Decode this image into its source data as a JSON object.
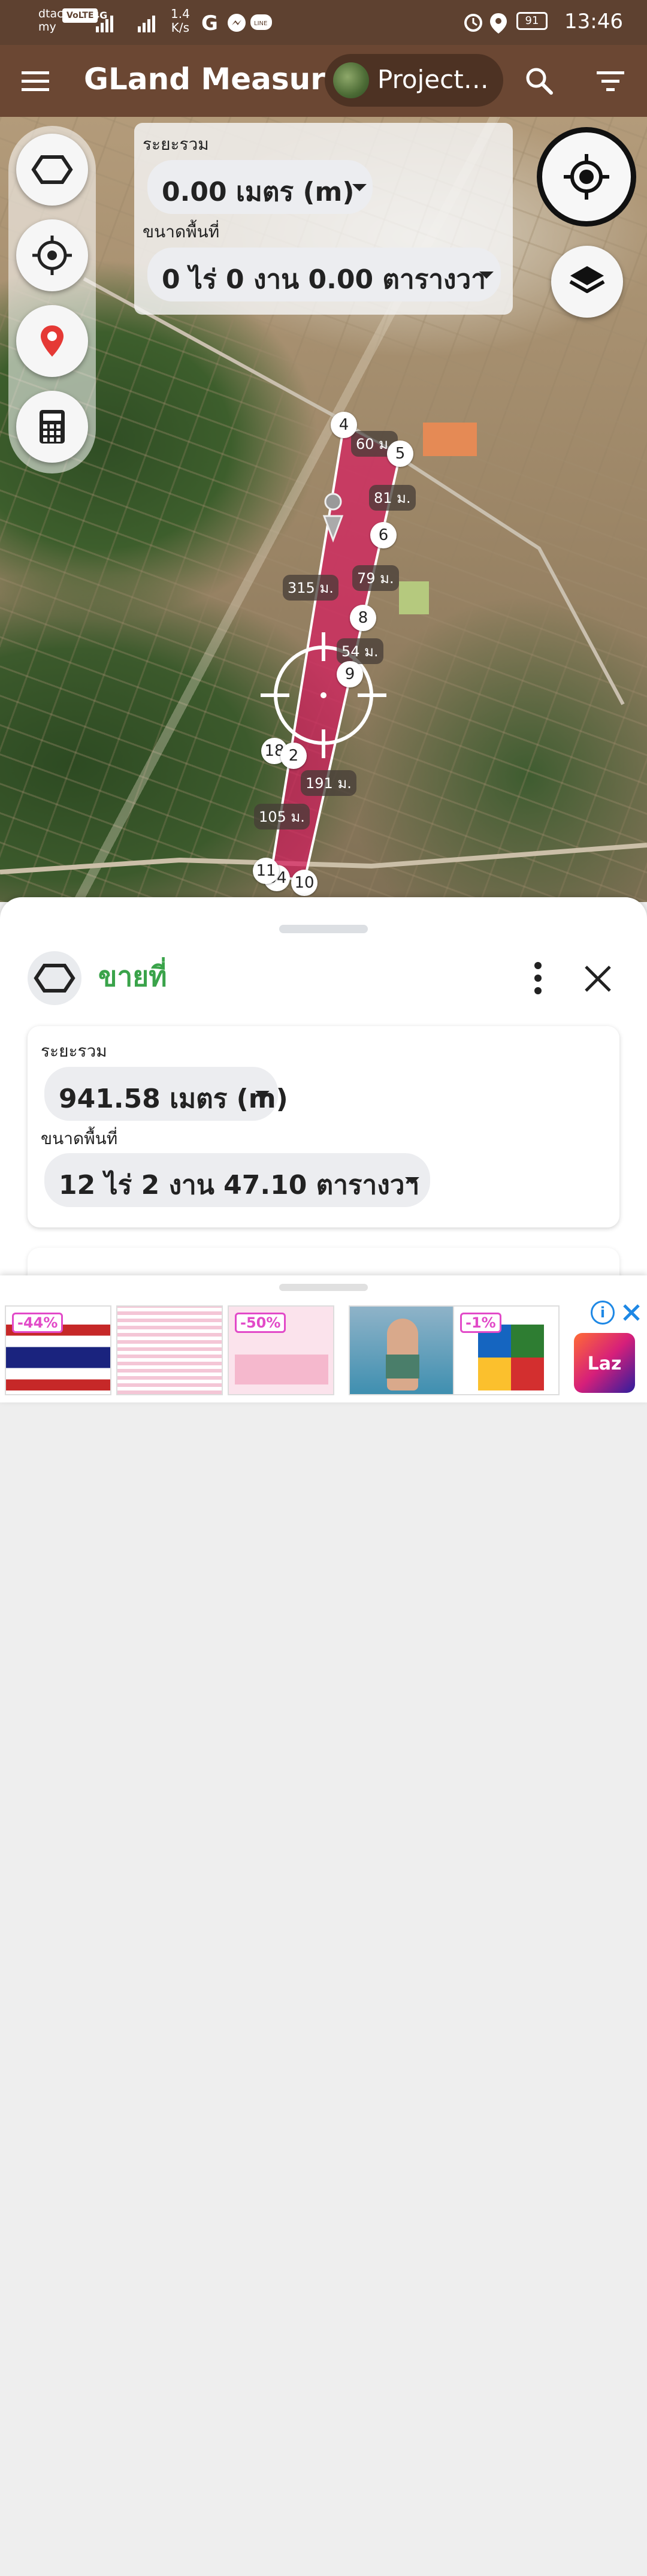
{
  "status_bar": {
    "carrier": "dtac",
    "carrier_sub": "my",
    "volte": "VoLTE",
    "network": "4G",
    "speed_value": "1.4",
    "speed_unit": "K/s",
    "battery": "91",
    "time": "13:46"
  },
  "app_bar": {
    "title": "GLand Measure",
    "project_chip": "Project…",
    "icons": [
      "menu-icon",
      "search-icon",
      "filter-icon"
    ]
  },
  "map_overlay": {
    "distance_label": "ระยะรวม",
    "distance_value": "0.00 เมตร (m)",
    "area_label": "ขนาดพื้นที่",
    "area_value": "0 ไร่ 0 งาน 0.00 ตารางวา",
    "tools": [
      "polygon-icon",
      "crosshair-icon",
      "pin-icon",
      "calculator-icon"
    ],
    "right_buttons": [
      "my-location-icon",
      "layers-icon"
    ]
  },
  "map": {
    "polygon_color": "#d81b60",
    "vertices": [
      "2",
      "4",
      "5",
      "6",
      "8",
      "9",
      "10",
      "11"
    ],
    "partial_labels": [
      "18",
      "34"
    ],
    "distances": [
      "60 ม.",
      "81 ม.",
      "79 ม.",
      "315 ม.",
      "54 ม.",
      "191 ม.",
      "105 ม."
    ]
  },
  "sheet": {
    "name": "ขายที่",
    "distance_label": "ระยะรวม",
    "distance_value": "941.58 เมตร (m)",
    "area_label": "ขนาดพื้นที่",
    "area_value": "12 ไร่ 2 งาน 47.10 ตารางวา"
  },
  "ad": {
    "tags": [
      "-44%",
      "-50%",
      "-1%"
    ],
    "brand": "Laz"
  }
}
